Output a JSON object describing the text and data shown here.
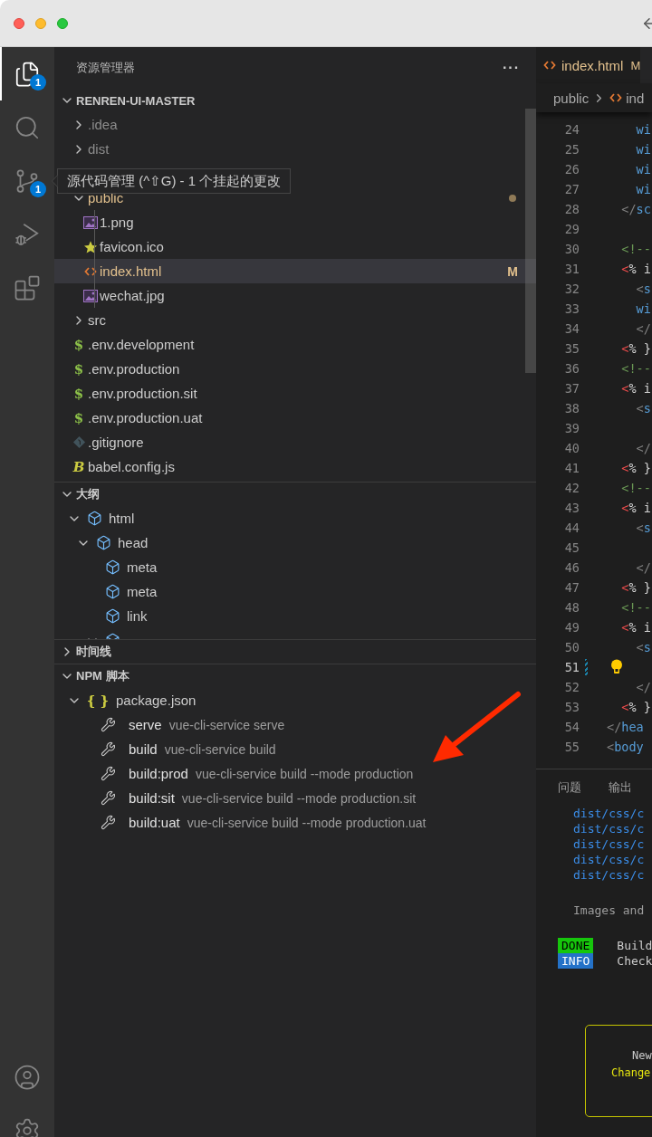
{
  "activity_bar": {
    "items": [
      {
        "kind": "explorer",
        "selected": true,
        "badge": "1"
      },
      {
        "kind": "search",
        "selected": false
      },
      {
        "kind": "source_control",
        "selected": false,
        "badge": "1"
      },
      {
        "kind": "run_debug",
        "selected": false
      },
      {
        "kind": "extensions",
        "selected": false
      }
    ],
    "bottom_items": [
      {
        "kind": "account"
      },
      {
        "kind": "settings"
      }
    ]
  },
  "sidebar": {
    "title": "资源管理器",
    "more": "···",
    "sections": [
      {
        "kind": "explorer",
        "title": "RENREN-UI-MASTER",
        "expanded": true,
        "items": [
          {
            "kind": "folder",
            "label": ".idea",
            "expanded": false,
            "ignored": true,
            "modified": false,
            "selected": false
          },
          {
            "kind": "folder",
            "label": "dist",
            "expanded": false,
            "ignored": true,
            "modified": false,
            "selected": false
          },
          {
            "kind": "tooltip",
            "text": "源代码管理 (^⇧G) - 1 个挂起的更改"
          },
          {
            "kind": "folder",
            "label": "public",
            "expanded": true,
            "ignored": false,
            "modified": true,
            "selected": false,
            "children": [
              {
                "kind": "image",
                "label": "1.png",
                "selected": false
              },
              {
                "kind": "favicon",
                "label": "favicon.ico",
                "selected": false
              },
              {
                "kind": "html",
                "label": "index.html",
                "selected": true,
                "status": "M"
              },
              {
                "kind": "image",
                "label": "wechat.jpg",
                "selected": false
              }
            ]
          },
          {
            "kind": "folder",
            "label": "src",
            "expanded": false,
            "ignored": false,
            "modified": false,
            "selected": false
          },
          {
            "kind": "env",
            "icon_text": "$",
            "label": ".env.development",
            "selected": false
          },
          {
            "kind": "env",
            "icon_text": "$",
            "label": ".env.production",
            "selected": false
          },
          {
            "kind": "env",
            "icon_text": "$",
            "label": ".env.production.sit",
            "selected": false
          },
          {
            "kind": "env",
            "icon_text": "$",
            "label": ".env.production.uat",
            "selected": false
          },
          {
            "kind": "gitignore",
            "label": ".gitignore",
            "selected": false
          },
          {
            "kind": "babel",
            "icon_text": "B",
            "label": "babel.config.js",
            "selected": false
          }
        ]
      },
      {
        "kind": "outline",
        "title": "大纲",
        "expanded": true,
        "items": [
          {
            "label": "html",
            "expanded": true,
            "selected": false,
            "children": [
              {
                "label": "head",
                "expanded": true,
                "selected": false,
                "children": [
                  {
                    "label": "meta",
                    "selected": false
                  },
                  {
                    "label": "meta",
                    "selected": false
                  },
                  {
                    "label": "link",
                    "selected": false
                  },
                  {
                    "expanded": true,
                    "selected": false
                  }
                ]
              }
            ]
          }
        ]
      },
      {
        "kind": "timeline",
        "title": "时间线",
        "expanded": false
      },
      {
        "kind": "npm",
        "title": "NPM 脚本",
        "expanded": true,
        "items": [
          {
            "icon_text": "{ }",
            "label": "package.json",
            "expanded": true,
            "selected": false,
            "scripts": [
              {
                "name": "serve",
                "command": "vue-cli-service serve",
                "selected": false
              },
              {
                "name": "build",
                "command": "vue-cli-service build",
                "selected": false
              },
              {
                "name": "build:prod",
                "command": "vue-cli-service build --mode production",
                "selected": false
              },
              {
                "name": "build:sit",
                "command": "vue-cli-service build --mode production.sit",
                "selected": false
              },
              {
                "name": "build:uat",
                "command": "vue-cli-service build --mode production.uat",
                "selected": false
              }
            ]
          }
        ]
      }
    ]
  },
  "editor": {
    "tab": {
      "label": "index.html",
      "status": "M",
      "selected": true
    },
    "breadcrumb": [
      "public",
      "ind"
    ],
    "lines": [
      {
        "number": "24",
        "tokens": [
          {
            "kind": "tag",
            "text": "    wi"
          }
        ]
      },
      {
        "number": "25",
        "tokens": [
          {
            "kind": "tag",
            "text": "    wi"
          }
        ]
      },
      {
        "number": "26",
        "tokens": [
          {
            "kind": "tag",
            "text": "    wi"
          }
        ]
      },
      {
        "number": "27",
        "tokens": [
          {
            "kind": "tag",
            "text": "    wi"
          }
        ]
      },
      {
        "number": "28",
        "tokens": [
          {
            "kind": "punct",
            "text": "  </"
          },
          {
            "kind": "tag",
            "text": "sc"
          }
        ]
      },
      {
        "number": "29"
      },
      {
        "number": "30",
        "tokens": [
          {
            "kind": "comment",
            "text": "  <!--"
          }
        ]
      },
      {
        "number": "31",
        "tokens": [
          {
            "kind": "delim",
            "text": "  <"
          },
          {
            "kind": "text",
            "text": "% i"
          }
        ]
      },
      {
        "number": "32",
        "tokens": [
          {
            "kind": "punct",
            "text": "    <"
          },
          {
            "kind": "tag",
            "text": "s"
          }
        ]
      },
      {
        "number": "33",
        "tokens": [
          {
            "kind": "tag",
            "text": "    wi"
          }
        ]
      },
      {
        "number": "34",
        "tokens": [
          {
            "kind": "punct",
            "text": "    </"
          }
        ]
      },
      {
        "number": "35",
        "tokens": [
          {
            "kind": "delim",
            "text": "  <"
          },
          {
            "kind": "text",
            "text": "% }"
          }
        ]
      },
      {
        "number": "36",
        "tokens": [
          {
            "kind": "comment",
            "text": "  <!--"
          }
        ]
      },
      {
        "number": "37",
        "tokens": [
          {
            "kind": "delim",
            "text": "  <"
          },
          {
            "kind": "text",
            "text": "% i"
          }
        ]
      },
      {
        "number": "38",
        "tokens": [
          {
            "kind": "punct",
            "text": "    <"
          },
          {
            "kind": "tag",
            "text": "s"
          }
        ]
      },
      {
        "number": "39"
      },
      {
        "number": "40",
        "tokens": [
          {
            "kind": "punct",
            "text": "    </"
          }
        ]
      },
      {
        "number": "41",
        "tokens": [
          {
            "kind": "delim",
            "text": "  <"
          },
          {
            "kind": "text",
            "text": "% }"
          }
        ]
      },
      {
        "number": "42",
        "tokens": [
          {
            "kind": "comment",
            "text": "  <!--"
          }
        ]
      },
      {
        "number": "43",
        "tokens": [
          {
            "kind": "delim",
            "text": "  <"
          },
          {
            "kind": "text",
            "text": "% i"
          }
        ]
      },
      {
        "number": "44",
        "tokens": [
          {
            "kind": "punct",
            "text": "    <"
          },
          {
            "kind": "tag",
            "text": "s"
          }
        ]
      },
      {
        "number": "45"
      },
      {
        "number": "46",
        "tokens": [
          {
            "kind": "punct",
            "text": "    </"
          }
        ]
      },
      {
        "number": "47",
        "tokens": [
          {
            "kind": "delim",
            "text": "  <"
          },
          {
            "kind": "text",
            "text": "% }"
          }
        ]
      },
      {
        "number": "48",
        "tokens": [
          {
            "kind": "comment",
            "text": "  <!--"
          }
        ]
      },
      {
        "number": "49",
        "tokens": [
          {
            "kind": "delim",
            "text": "  <"
          },
          {
            "kind": "text",
            "text": "% i"
          }
        ]
      },
      {
        "number": "50",
        "tokens": [
          {
            "kind": "punct",
            "text": "    <"
          },
          {
            "kind": "tag",
            "text": "s"
          }
        ]
      },
      {
        "number": "51",
        "active": true,
        "lightbulb": true,
        "modified": true
      },
      {
        "number": "52",
        "tokens": [
          {
            "kind": "punct",
            "text": "    </"
          }
        ]
      },
      {
        "number": "53",
        "tokens": [
          {
            "kind": "delim",
            "text": "  <"
          },
          {
            "kind": "text",
            "text": "% }"
          }
        ]
      },
      {
        "number": "54",
        "tokens": [
          {
            "kind": "punct",
            "text": "</"
          },
          {
            "kind": "tag",
            "text": "hea"
          }
        ]
      },
      {
        "number": "55",
        "tokens": [
          {
            "kind": "punct",
            "text": "<"
          },
          {
            "kind": "tag",
            "text": "body"
          }
        ]
      }
    ],
    "panel": {
      "tabs": [
        {
          "label": "问题",
          "selected": false
        },
        {
          "label": "输出",
          "selected": false
        }
      ],
      "output": [
        {
          "kind": "path",
          "text": "dist/css/c"
        },
        {
          "kind": "path",
          "text": "dist/css/c"
        },
        {
          "kind": "path",
          "text": "dist/css/c"
        },
        {
          "kind": "path",
          "text": "dist/css/c"
        },
        {
          "kind": "path",
          "text": "dist/css/c"
        },
        {
          "kind": "blank"
        },
        {
          "kind": "info",
          "text": "Images and"
        },
        {
          "kind": "blank"
        },
        {
          "kind": "badge",
          "badge": "DONE",
          "color": "#16c60c",
          "text": "Build"
        },
        {
          "kind": "badge",
          "badge": "INFO",
          "color": "#2472c8",
          "text": "Check"
        }
      ],
      "notice": [
        {
          "kind": "plain",
          "text": "New"
        },
        {
          "kind": "highlight",
          "text": "Change"
        }
      ]
    }
  }
}
